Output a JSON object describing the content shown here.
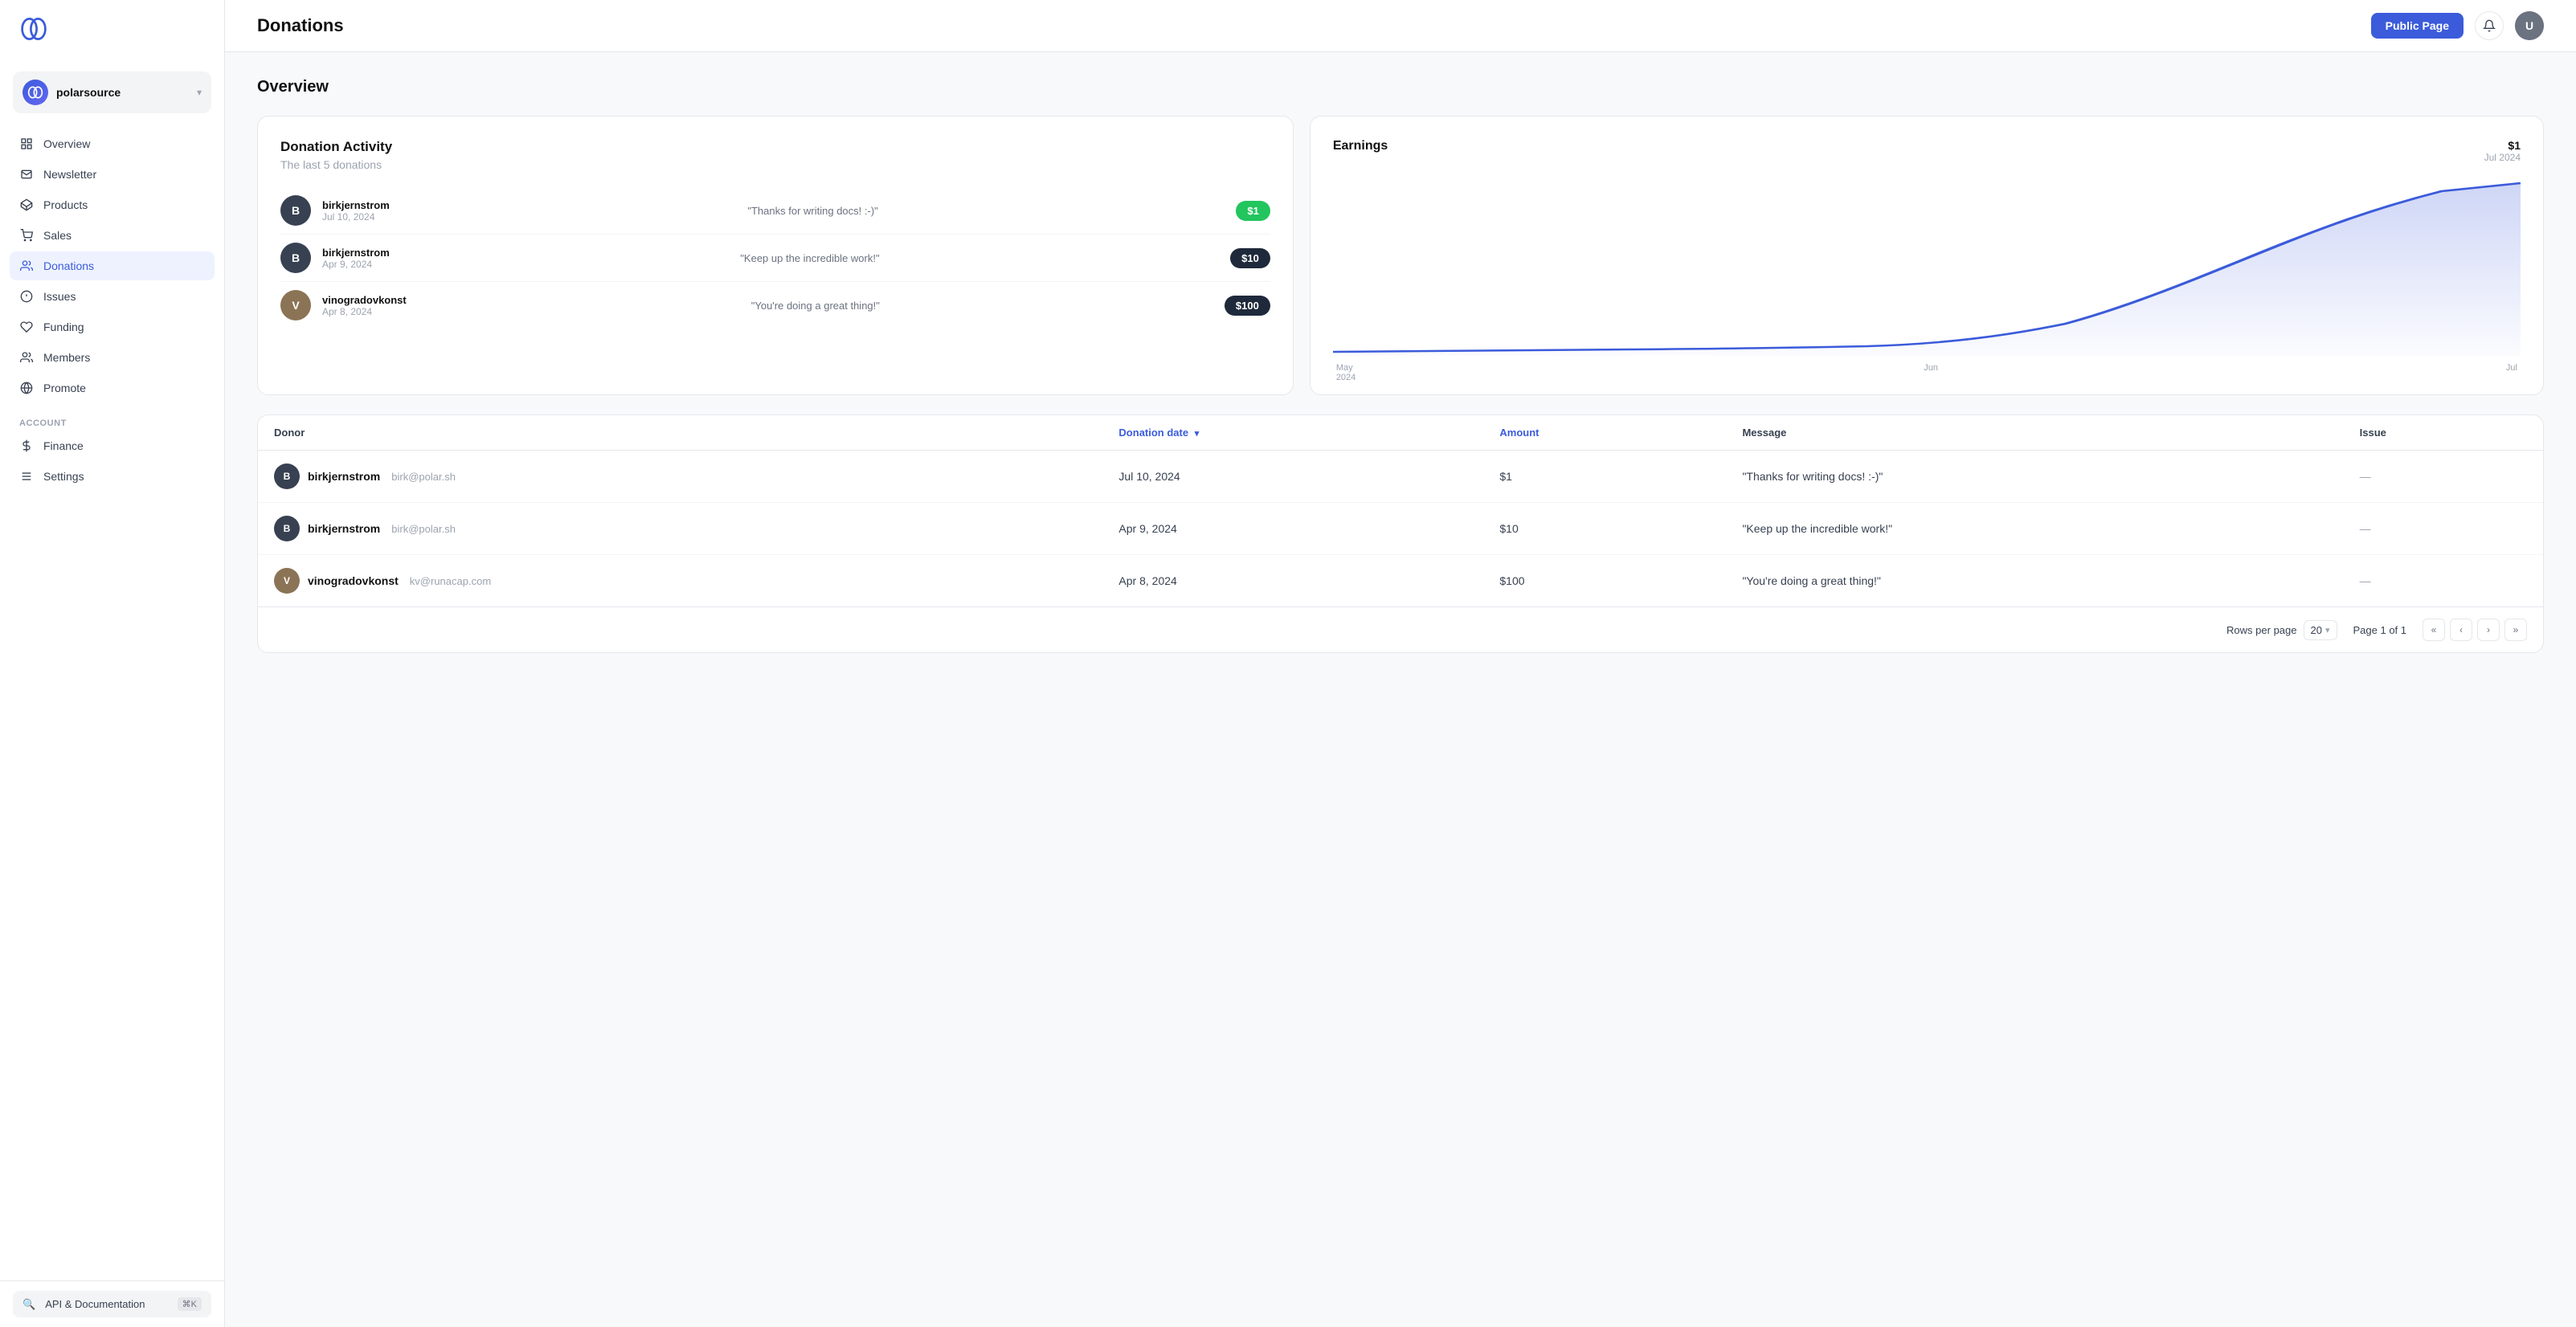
{
  "app": {
    "logo_label": "Polar"
  },
  "sidebar": {
    "org_name": "polarsource",
    "nav_items": [
      {
        "id": "overview",
        "label": "Overview",
        "icon": "grid-icon",
        "active": false
      },
      {
        "id": "newsletter",
        "label": "Newsletter",
        "icon": "newsletter-icon",
        "active": false
      },
      {
        "id": "products",
        "label": "Products",
        "icon": "products-icon",
        "active": false
      },
      {
        "id": "sales",
        "label": "Sales",
        "icon": "sales-icon",
        "active": false
      },
      {
        "id": "donations",
        "label": "Donations",
        "icon": "donations-icon",
        "active": true
      },
      {
        "id": "issues",
        "label": "Issues",
        "icon": "issues-icon",
        "active": false
      },
      {
        "id": "funding",
        "label": "Funding",
        "icon": "funding-icon",
        "active": false
      },
      {
        "id": "members",
        "label": "Members",
        "icon": "members-icon",
        "active": false
      },
      {
        "id": "promote",
        "label": "Promote",
        "icon": "promote-icon",
        "active": false
      }
    ],
    "account_section": "ACCOUNT",
    "account_items": [
      {
        "id": "finance",
        "label": "Finance",
        "icon": "finance-icon"
      },
      {
        "id": "settings",
        "label": "Settings",
        "icon": "settings-icon"
      }
    ],
    "api_docs_label": "API & Documentation",
    "api_shortcut": "⌘K"
  },
  "topbar": {
    "page_title": "Donations",
    "public_page_btn": "Public Page"
  },
  "overview": {
    "title": "Overview",
    "activity_card": {
      "title": "Donation Activity",
      "subtitle": "The last 5 donations",
      "donations": [
        {
          "donor": "birkjernstrom",
          "date": "Jul 10, 2024",
          "message": "\"Thanks for writing docs! :-)\"",
          "amount": "$1",
          "amount_color": "green",
          "initials": "B"
        },
        {
          "donor": "birkjernstrom",
          "date": "Apr 9, 2024",
          "message": "\"Keep up the incredible work!\"",
          "amount": "$10",
          "amount_color": "dark",
          "initials": "B"
        },
        {
          "donor": "vinogradovkonst",
          "date": "Apr 8, 2024",
          "message": "\"You're doing a great thing!\"",
          "amount": "$100",
          "amount_color": "dark",
          "initials": "V"
        }
      ]
    },
    "earnings_card": {
      "title": "Earnings",
      "amount": "$1",
      "date": "Jul 2024",
      "chart_labels": [
        "May\n2024",
        "Jun",
        "Jul"
      ]
    }
  },
  "table": {
    "columns": [
      {
        "id": "donor",
        "label": "Donor",
        "sortable": false,
        "highlight": false
      },
      {
        "id": "donation_date",
        "label": "Donation date",
        "sortable": true,
        "highlight": true
      },
      {
        "id": "amount",
        "label": "Amount",
        "sortable": false,
        "highlight": true
      },
      {
        "id": "message",
        "label": "Message",
        "sortable": false,
        "highlight": false
      },
      {
        "id": "issue",
        "label": "Issue",
        "sortable": false,
        "highlight": false
      }
    ],
    "rows": [
      {
        "donor_name": "birkjernstrom",
        "donor_email": "birk@polar.sh",
        "donation_date": "Jul 10, 2024",
        "amount": "$1",
        "message": "\"Thanks for writing docs! :-)\"",
        "issue": "—",
        "initials": "B"
      },
      {
        "donor_name": "birkjernstrom",
        "donor_email": "birk@polar.sh",
        "donation_date": "Apr 9, 2024",
        "amount": "$10",
        "message": "\"Keep up the incredible work!\"",
        "issue": "—",
        "initials": "B"
      },
      {
        "donor_name": "vinogradovkonst",
        "donor_email": "kv@runacap.com",
        "donation_date": "Apr 8, 2024",
        "amount": "$100",
        "message": "\"You're doing a great thing!\"",
        "issue": "—",
        "initials": "V"
      }
    ],
    "footer": {
      "rows_per_page_label": "Rows per page",
      "rows_per_page_value": "20",
      "page_info": "Page 1 of 1"
    }
  }
}
